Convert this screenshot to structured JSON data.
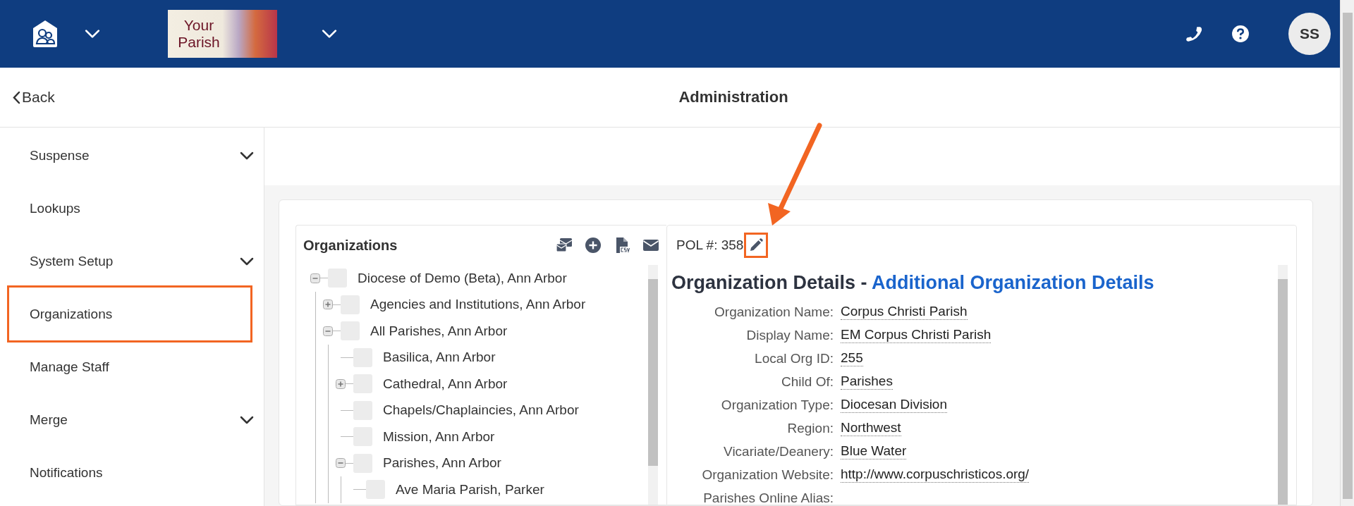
{
  "header": {
    "logo_text": "Your Parish",
    "avatar": "SS"
  },
  "page_title": "Administration",
  "back": "Back",
  "sidebar": {
    "items": [
      {
        "label": "Suspense",
        "expandable": true,
        "highlighted": false
      },
      {
        "label": "Lookups",
        "expandable": false,
        "highlighted": false
      },
      {
        "label": "System Setup",
        "expandable": true,
        "highlighted": false
      },
      {
        "label": "Organizations",
        "expandable": false,
        "highlighted": true
      },
      {
        "label": "Manage Staff",
        "expandable": false,
        "highlighted": false
      },
      {
        "label": "Merge",
        "expandable": true,
        "highlighted": false
      },
      {
        "label": "Notifications",
        "expandable": false,
        "highlighted": false
      }
    ]
  },
  "organizations": {
    "title": "Organizations",
    "tree": [
      {
        "label": "Diocese of Demo (Beta), Ann Arbor",
        "checked": false,
        "expanded": true,
        "children": [
          {
            "label": "Agencies and Institutions, Ann Arbor",
            "checked": false,
            "expanded": false
          },
          {
            "label": "All Parishes, Ann Arbor",
            "checked": false,
            "expanded": true,
            "children": [
              {
                "label": "Basilica, Ann Arbor",
                "checked": false
              },
              {
                "label": "Cathedral, Ann Arbor",
                "checked": false,
                "expanded": false
              },
              {
                "label": "Chapels/Chaplaincies, Ann Arbor",
                "checked": false
              },
              {
                "label": "Mission, Ann Arbor",
                "checked": false
              },
              {
                "label": "Parishes, Ann Arbor",
                "checked": false,
                "expanded": true,
                "children": [
                  {
                    "label": "Ave Maria Parish, Parker",
                    "checked": false
                  }
                ]
              }
            ]
          }
        ]
      }
    ]
  },
  "details": {
    "pol": "POL #: 358",
    "edit_highlighted": true,
    "heading": "Organization Details -",
    "heading_link": "Additional Organization Details",
    "fields": [
      {
        "label": "Organization Name:",
        "value": "Corpus Christi Parish"
      },
      {
        "label": "Display Name:",
        "value": "EM Corpus Christi Parish"
      },
      {
        "label": "Local Org ID:",
        "value": "255"
      },
      {
        "label": "Child Of:",
        "value": "Parishes"
      },
      {
        "label": "Organization Type:",
        "value": "Diocesan Division"
      },
      {
        "label": "Region:",
        "value": "Northwest"
      },
      {
        "label": "Vicariate/Deanery:",
        "value": "Blue Water"
      },
      {
        "label": "Organization Website:",
        "value": "http://www.corpuschristicos.org/"
      },
      {
        "label": "Parishes Online Alias:"
      }
    ]
  }
}
